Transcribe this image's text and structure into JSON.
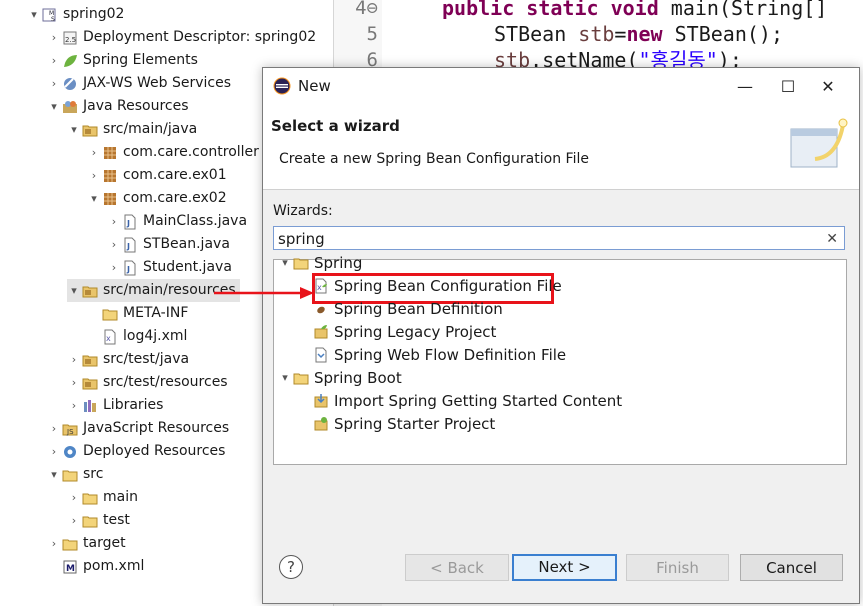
{
  "colors": {
    "accent_red": "#e8131a",
    "selection": "#e4e4e4",
    "keyword": "#7f0055",
    "string": "#2a00ff"
  },
  "explorer": {
    "items": [
      {
        "label": "spring02",
        "twisty": "▾",
        "icon": "maven-project-icon",
        "indent": 0
      },
      {
        "label": "Deployment Descriptor: spring02",
        "twisty": "›",
        "icon": "deployment-descriptor-icon",
        "indent": 1
      },
      {
        "label": "Spring Elements",
        "twisty": "›",
        "icon": "spring-leaf-icon",
        "indent": 1
      },
      {
        "label": "JAX-WS Web Services",
        "twisty": "›",
        "icon": "web-services-icon",
        "indent": 1
      },
      {
        "label": "Java Resources",
        "twisty": "▾",
        "icon": "java-resources-icon",
        "indent": 1
      },
      {
        "label": "src/main/java",
        "twisty": "▾",
        "icon": "source-folder-icon",
        "indent": 2
      },
      {
        "label": "com.care.controller",
        "twisty": "›",
        "icon": "package-icon",
        "indent": 3
      },
      {
        "label": "com.care.ex01",
        "twisty": "›",
        "icon": "package-icon",
        "indent": 3
      },
      {
        "label": "com.care.ex02",
        "twisty": "▾",
        "icon": "package-icon",
        "indent": 3
      },
      {
        "label": "MainClass.java",
        "twisty": "›",
        "icon": "java-file-icon",
        "indent": 4
      },
      {
        "label": "STBean.java",
        "twisty": "›",
        "icon": "java-file-icon",
        "indent": 4
      },
      {
        "label": "Student.java",
        "twisty": "›",
        "icon": "java-file-icon",
        "indent": 4
      },
      {
        "label": "src/main/resources",
        "twisty": "▾",
        "icon": "source-folder-icon",
        "indent": 2,
        "selected": true
      },
      {
        "label": "META-INF",
        "twisty": "",
        "icon": "folder-icon",
        "indent": 3
      },
      {
        "label": "log4j.xml",
        "twisty": "",
        "icon": "xml-file-icon",
        "indent": 3
      },
      {
        "label": "src/test/java",
        "twisty": "›",
        "icon": "source-folder-icon",
        "indent": 2
      },
      {
        "label": "src/test/resources",
        "twisty": "›",
        "icon": "source-folder-icon",
        "indent": 2
      },
      {
        "label": "Libraries",
        "twisty": "›",
        "icon": "libraries-icon",
        "indent": 2
      },
      {
        "label": "JavaScript Resources",
        "twisty": "›",
        "icon": "javascript-resources-icon",
        "indent": 1
      },
      {
        "label": "Deployed Resources",
        "twisty": "›",
        "icon": "deployed-resources-icon",
        "indent": 1
      },
      {
        "label": "src",
        "twisty": "▾",
        "icon": "folder-icon",
        "indent": 1
      },
      {
        "label": "main",
        "twisty": "›",
        "icon": "folder-icon",
        "indent": 2
      },
      {
        "label": "test",
        "twisty": "›",
        "icon": "folder-icon",
        "indent": 2
      },
      {
        "label": "target",
        "twisty": "›",
        "icon": "folder-icon",
        "indent": 1
      },
      {
        "label": "pom.xml",
        "twisty": "",
        "icon": "maven-pom-icon",
        "indent": 1
      }
    ]
  },
  "editor": {
    "line_numbers": [
      "4⊖",
      "5",
      "6"
    ],
    "line1": {
      "kw": "public static void ",
      "rest": "main(String[]"
    },
    "line2": {
      "type": "STBean ",
      "var": "stb",
      "eq": "=",
      "kw": "new",
      "rest": " STBean();"
    },
    "line3": {
      "var": "stb",
      "call": ".setName(",
      "str": "\"홍길동\"",
      "end": ");"
    }
  },
  "dialog": {
    "title": "New",
    "header_title": "Select a wizard",
    "header_desc": "Create a new Spring Bean Configuration File",
    "wizards_label": "Wizards:",
    "search_value": "spring",
    "tree": [
      {
        "label": "Spring",
        "twisty": "▾",
        "icon": "folder-icon",
        "indent": 0
      },
      {
        "label": "Spring Bean Configuration File",
        "twisty": "",
        "icon": "spring-bean-config-icon",
        "indent": 1,
        "highlighted": true
      },
      {
        "label": "Spring Bean Definition",
        "twisty": "",
        "icon": "bean-definition-icon",
        "indent": 1
      },
      {
        "label": "Spring Legacy Project",
        "twisty": "",
        "icon": "spring-project-icon",
        "indent": 1
      },
      {
        "label": "Spring Web Flow Definition File",
        "twisty": "",
        "icon": "web-flow-icon",
        "indent": 1
      },
      {
        "label": "Spring Boot",
        "twisty": "▾",
        "icon": "folder-icon",
        "indent": 0
      },
      {
        "label": "Import Spring Getting Started Content",
        "twisty": "",
        "icon": "import-spring-icon",
        "indent": 1
      },
      {
        "label": "Spring Starter Project",
        "twisty": "",
        "icon": "spring-starter-icon",
        "indent": 1
      }
    ],
    "buttons": {
      "back": "< Back",
      "next": "Next >",
      "finish": "Finish",
      "cancel": "Cancel"
    },
    "window_buttons": {
      "minimize": "—",
      "maximize": "☐",
      "close": "✕"
    }
  }
}
